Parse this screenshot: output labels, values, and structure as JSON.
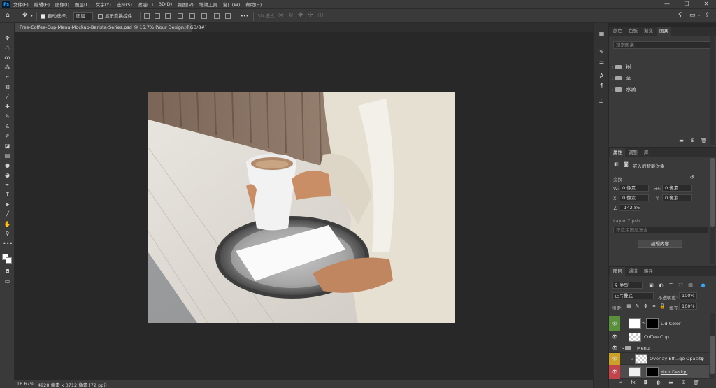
{
  "app": {
    "logo": "Ps"
  },
  "menu": {
    "items": [
      "文件(F)",
      "编辑(E)",
      "图像(I)",
      "图层(L)",
      "文字(Y)",
      "选择(S)",
      "滤镜(T)",
      "3D(D)",
      "视图(V)",
      "增效工具",
      "窗口(W)",
      "帮助(H)"
    ]
  },
  "window": {
    "minimize": "—",
    "maximize": "☐",
    "close": "✕"
  },
  "options": {
    "auto_select_label": "自动选择：",
    "auto_select_value": "图层",
    "show_transform_label": "显示变换控件",
    "mode_3d_label": "3D 模式：",
    "more": "•••"
  },
  "document": {
    "tab_title": "Free-Coffee-Cup-Menu-Mockup-Barista-Series.psd @ 16.7% (Your Design, RGB/8#)",
    "close": "×"
  },
  "status": {
    "zoom": "16.67%",
    "doc_info": "4928 像素 x 3712 像素 (72 ppi)",
    "arrow": "〉"
  },
  "colors": {
    "eye_green": "#5a8f3c",
    "eye_yellow": "#c9a227",
    "eye_red": "#c0454a",
    "accent_blue": "#31a8ff"
  },
  "top_panel": {
    "tabs": [
      "颜色",
      "色板",
      "渐变",
      "图案"
    ],
    "search_placeholder": "搜索图案",
    "folders": [
      "树",
      "草",
      "水滴"
    ]
  },
  "properties": {
    "tabs": [
      "属性",
      "调整",
      "库"
    ],
    "object_type": "嵌入的智能对象",
    "transform_label": "变换",
    "w_label": "W:",
    "w_value": "0 像素",
    "h_label": "H:",
    "h_value": "0 像素",
    "x_label": "X:",
    "x_value": "0 像素",
    "y_label": "Y:",
    "y_value": "0 像素",
    "angle_value": "-142.86",
    "file_name": "Layer 7.psb",
    "comp_placeholder": "不应用图层复合",
    "edit_button": "编辑内容"
  },
  "layers_panel": {
    "tabs": [
      "图层",
      "通道",
      "路径"
    ],
    "filter_kind": "类型",
    "blend_mode": "正片叠底",
    "opacity_label": "不透明度:",
    "opacity_value": "100%",
    "lock_label": "锁定:",
    "fill_label": "填充:",
    "fill_value": "100%",
    "layers": [
      {
        "name": "Lid Color"
      },
      {
        "name": "Coffee Cup"
      },
      {
        "name": "Menu"
      },
      {
        "name": "Overlay Eff...ge Opacity"
      },
      {
        "name": "Your Design"
      }
    ]
  }
}
